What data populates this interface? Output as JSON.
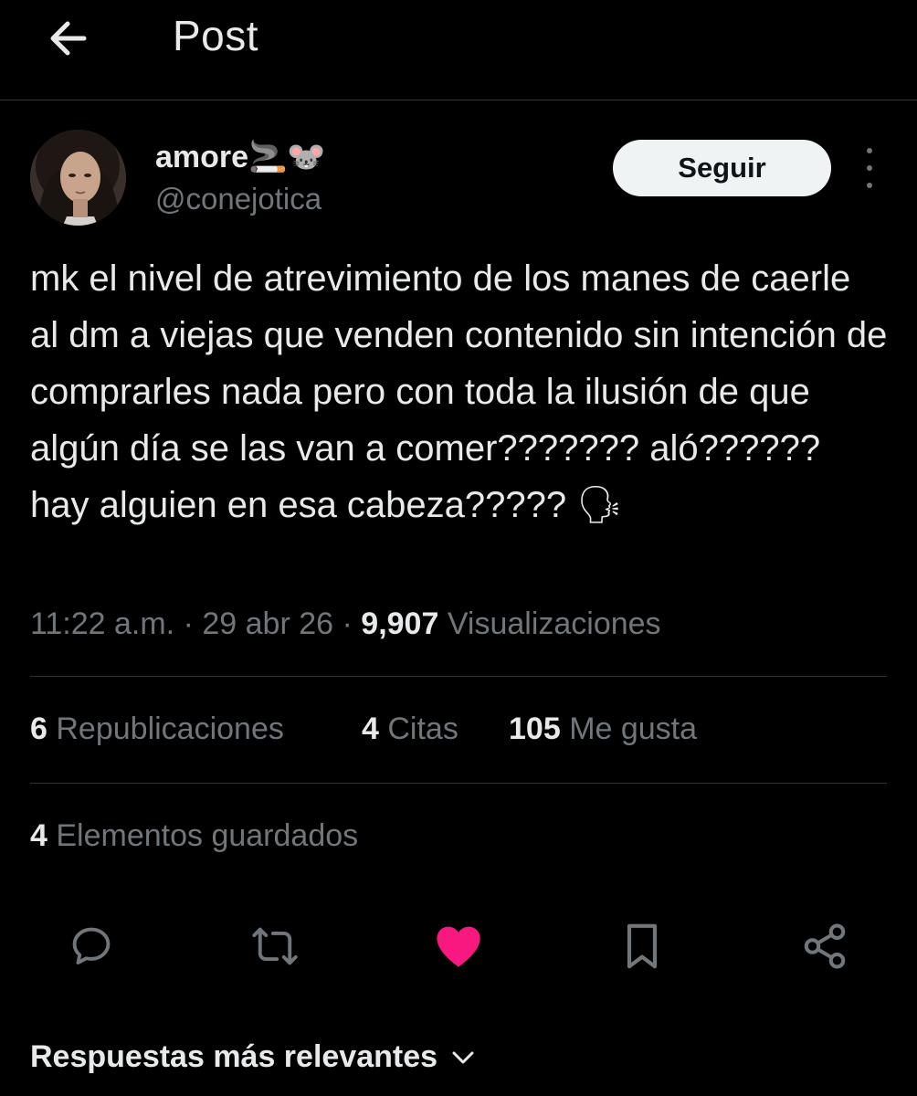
{
  "header": {
    "title": "Post"
  },
  "author": {
    "display_name": "amore",
    "display_name_emoji": "🚬🐭",
    "handle": "@conejotica",
    "follow_label": "Seguir"
  },
  "tweet": {
    "text": "mk el nivel de atrevimiento de los manes de caerle al dm a viejas que venden contenido sin intención de comprarles nada pero con toda la ilusión de que algún día se las van a comer??????? aló?????? hay alguien en esa cabeza????? 🗣",
    "time": "11:22 a.m.",
    "date": "29 abr 26",
    "views_count": "9,907",
    "views_label": "Visualizaciones",
    "separator": "·"
  },
  "stats": {
    "reposts_count": "6",
    "reposts_label": "Republicaciones",
    "quotes_count": "4",
    "quotes_label": "Citas",
    "likes_count": "105",
    "likes_label": "Me gusta",
    "bookmarks_count": "4",
    "bookmarks_label": "Elementos guardados"
  },
  "actions": [
    {
      "icon": "reply-icon"
    },
    {
      "icon": "repost-icon"
    },
    {
      "icon": "like-icon",
      "color": "#f91880",
      "active": true
    },
    {
      "icon": "bookmark-icon"
    },
    {
      "icon": "share-icon"
    }
  ],
  "replies": {
    "sort_label": "Respuestas más relevantes"
  },
  "colors": {
    "background": "#000000",
    "text": "#e7e9ea",
    "muted": "#71767b",
    "like": "#f91880",
    "divider": "#2f3336"
  }
}
